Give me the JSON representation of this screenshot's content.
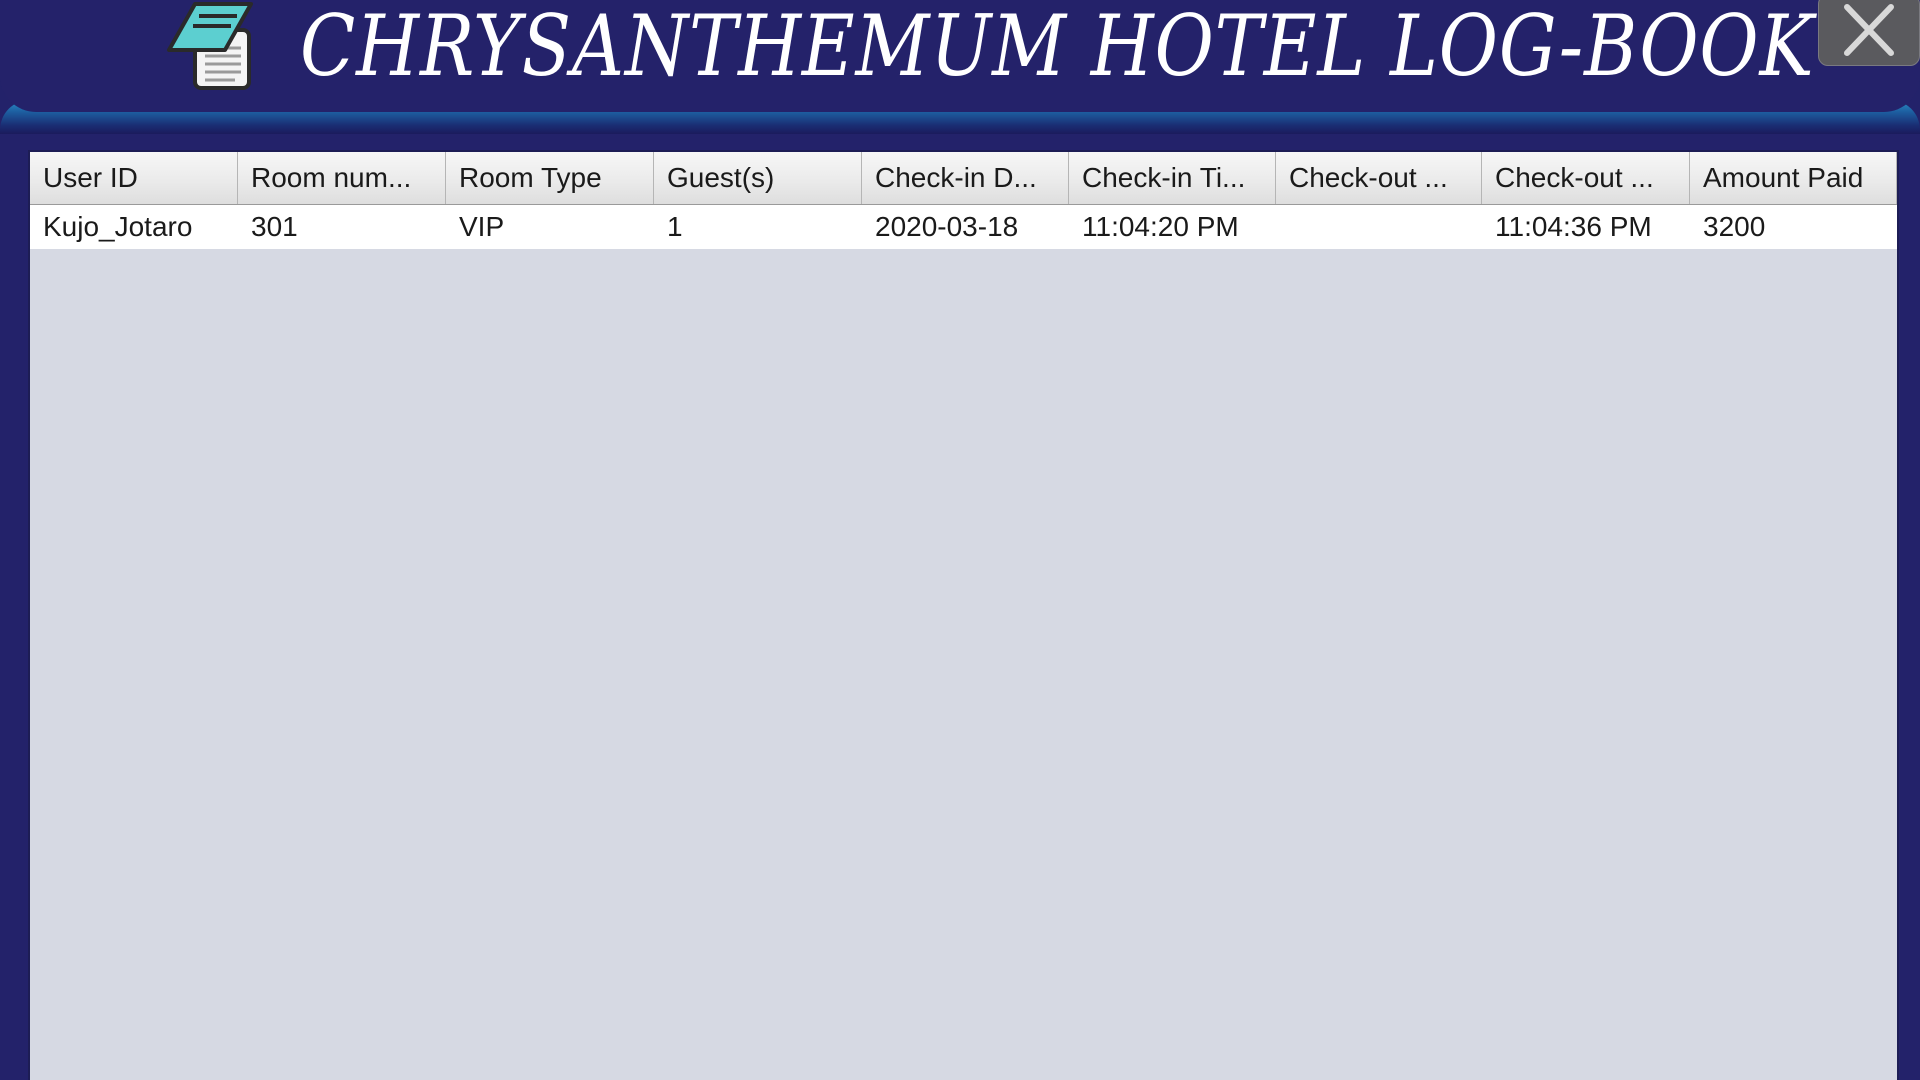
{
  "header": {
    "title": "CHRYSANTHEMUM HOTEL LOG-BOOK",
    "logo_icon": "notepad-icon",
    "close_icon": "close-icon"
  },
  "table": {
    "columns": [
      "User ID",
      "Room num...",
      "Room Type",
      "Guest(s)",
      "Check-in D...",
      "Check-in Ti...",
      "Check-out ...",
      "Check-out ...",
      "Amount Paid"
    ],
    "rows": [
      [
        "Kujo_Jotaro",
        "301",
        "VIP",
        "1",
        "2020-03-18",
        "11:04:20 PM",
        "",
        "11:04:36 PM",
        "3200"
      ]
    ]
  },
  "colors": {
    "header_bg": "#24226a",
    "accent_teal": "#5ccfd0",
    "table_bg": "#d6d9e3",
    "close_btn": "#5a5a5e"
  }
}
